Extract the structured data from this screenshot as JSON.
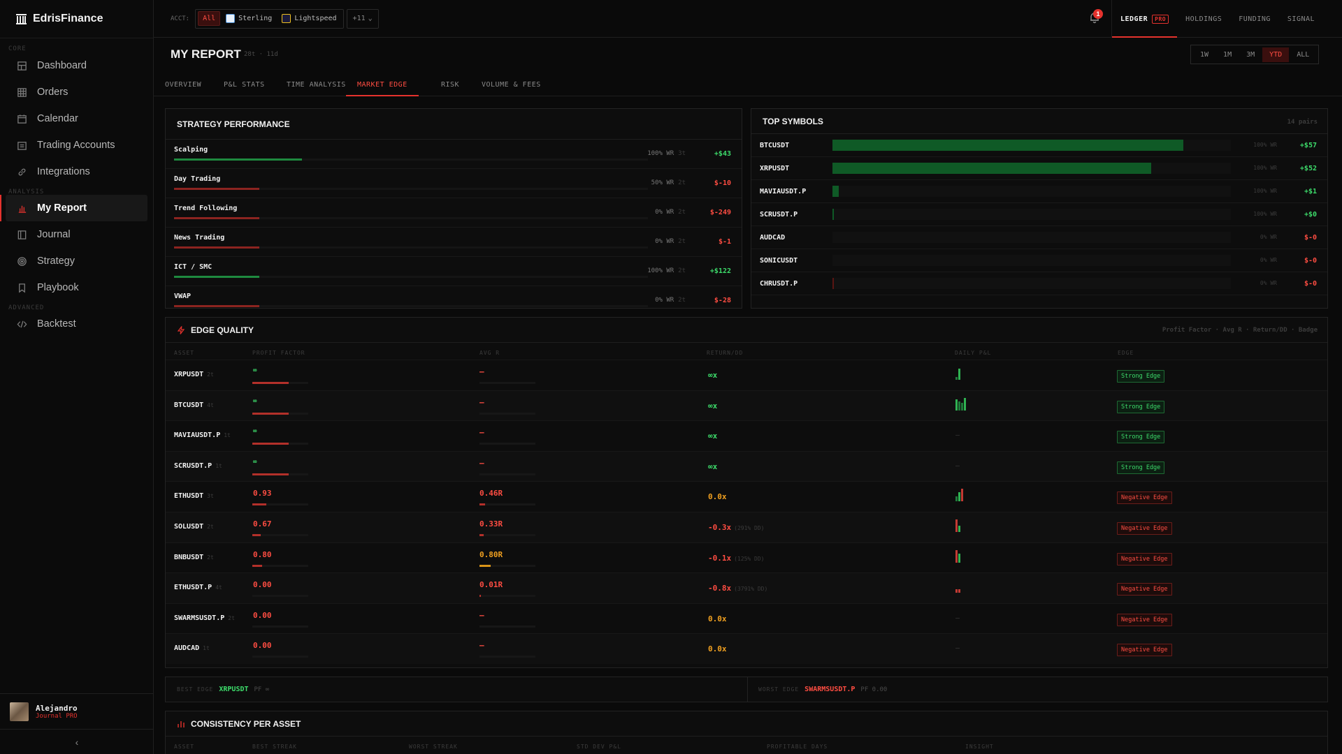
{
  "brand": {
    "name": "EdrisFinance"
  },
  "sidebar": {
    "sections": {
      "core": "CORE",
      "analysis": "ANALYSIS",
      "advanced": "ADVANCED"
    },
    "items": [
      {
        "label": "Dashboard",
        "icon": "dashboard-icon"
      },
      {
        "label": "Orders",
        "icon": "grid-icon"
      },
      {
        "label": "Calendar",
        "icon": "calendar-icon"
      },
      {
        "label": "Trading Accounts",
        "icon": "wallet-icon"
      },
      {
        "label": "Integrations",
        "icon": "link-icon"
      },
      {
        "label": "My Report",
        "icon": "bar-chart-icon",
        "active": true
      },
      {
        "label": "Journal",
        "icon": "book-icon"
      },
      {
        "label": "Strategy",
        "icon": "target-icon"
      },
      {
        "label": "Playbook",
        "icon": "bookmark-icon"
      },
      {
        "label": "Backtest",
        "icon": "code-icon"
      }
    ],
    "user": {
      "name": "Alejandro",
      "plan": "Journal PRO"
    },
    "collapse": "‹"
  },
  "topbar": {
    "acct_label": "ACCT:",
    "accounts": [
      "All",
      "Sterling",
      "Lightspeed"
    ],
    "more": "+11",
    "notification_count": "1",
    "nav": [
      {
        "label": "LEDGER",
        "tag": "PRO",
        "active": true
      },
      {
        "label": "HOLDINGS"
      },
      {
        "label": "FUNDING"
      },
      {
        "label": "SIGNAL"
      }
    ]
  },
  "page": {
    "title": "MY REPORT",
    "subtitle": "28t · 11d",
    "ranges": [
      "1W",
      "1M",
      "3M",
      "YTD",
      "ALL"
    ],
    "active_range": "YTD",
    "tabs": [
      "OVERVIEW",
      "P&L STATS",
      "TIME ANALYSIS",
      "MARKET EDGE",
      "RISK",
      "VOLUME & FEES"
    ],
    "active_tab": "MARKET EDGE"
  },
  "strategy_performance": {
    "title": "STRATEGY PERFORMANCE",
    "rows": [
      {
        "name": "Scalping",
        "wr": "100% WR",
        "trades": "3t",
        "pnl": "+$43",
        "positive": true,
        "bar_fraction": 0.27
      },
      {
        "name": "Day Trading",
        "wr": "50% WR",
        "trades": "2t",
        "pnl": "$-10",
        "positive": false,
        "bar_fraction": 0.18
      },
      {
        "name": "Trend Following",
        "wr": "0% WR",
        "trades": "2t",
        "pnl": "$-249",
        "positive": false,
        "bar_fraction": 0.18
      },
      {
        "name": "News Trading",
        "wr": "0% WR",
        "trades": "2t",
        "pnl": "$-1",
        "positive": false,
        "bar_fraction": 0.18
      },
      {
        "name": "ICT / SMC",
        "wr": "100% WR",
        "trades": "2t",
        "pnl": "+$122",
        "positive": true,
        "bar_fraction": 0.18
      },
      {
        "name": "VWAP",
        "wr": "0% WR",
        "trades": "2t",
        "pnl": "$-28",
        "positive": false,
        "bar_fraction": 0.18
      }
    ]
  },
  "top_symbols": {
    "title": "TOP SYMBOLS",
    "count": "14 pairs",
    "rows": [
      {
        "name": "BTCUSDT",
        "wr": "100% WR",
        "pnl": "+$57",
        "positive": true,
        "bar_fraction": 0.88
      },
      {
        "name": "XRPUSDT",
        "wr": "100% WR",
        "pnl": "+$52",
        "positive": true,
        "bar_fraction": 0.8
      },
      {
        "name": "MAVIAUSDT.P",
        "wr": "100% WR",
        "pnl": "+$1",
        "positive": true,
        "bar_fraction": 0.015
      },
      {
        "name": "SCRUSDT.P",
        "wr": "100% WR",
        "pnl": "+$0",
        "positive": true,
        "bar_fraction": 0.002
      },
      {
        "name": "AUDCAD",
        "wr": "0% WR",
        "pnl": "$-0",
        "positive": false,
        "bar_fraction": 0
      },
      {
        "name": "SONICUSDT",
        "wr": "0% WR",
        "pnl": "$-0",
        "positive": false,
        "bar_fraction": 0
      },
      {
        "name": "CHRUSDT.P",
        "wr": "0% WR",
        "pnl": "$-0",
        "positive": false,
        "bar_fraction": 0.002
      }
    ]
  },
  "edge_quality": {
    "title": "EDGE QUALITY",
    "legend": "Profit Factor · Avg R · Return/DD · Badge",
    "columns": [
      "ASSET",
      "PROFIT FACTOR",
      "AVG R",
      "RETURN/DD",
      "DAILY P&L",
      "EDGE"
    ],
    "rows": [
      {
        "asset": "XRPUSDT",
        "trades": "2t",
        "pf": "∞",
        "pf_color": "green",
        "pf_fill": 0.65,
        "avgr": "—",
        "avgr_color": "red",
        "avgr_fill": 0,
        "ret": "∞x",
        "ret_color": "green",
        "ret_dd": "",
        "daily": [
          0.2,
          0.9
        ],
        "daily_colors": [
          "#1f7a3a",
          "#2fb352"
        ],
        "edge": "Strong Edge",
        "strong": true
      },
      {
        "asset": "BTCUSDT",
        "trades": "4t",
        "pf": "∞",
        "pf_color": "green",
        "pf_fill": 0.65,
        "avgr": "—",
        "avgr_color": "red",
        "avgr_fill": 0,
        "ret": "∞x",
        "ret_color": "green",
        "ret_dd": "",
        "daily": [
          0.9,
          0.7,
          0.6,
          1.0
        ],
        "daily_colors": [
          "#2fb352",
          "#1f7a3a",
          "#1f7a3a",
          "#2fb352"
        ],
        "edge": "Strong Edge",
        "strong": true
      },
      {
        "asset": "MAVIAUSDT.P",
        "trades": "1t",
        "pf": "∞",
        "pf_color": "green",
        "pf_fill": 0.65,
        "avgr": "—",
        "avgr_color": "red",
        "avgr_fill": 0,
        "ret": "∞x",
        "ret_color": "green",
        "ret_dd": "",
        "daily": [],
        "daily_colors": [],
        "edge": "Strong Edge",
        "strong": true
      },
      {
        "asset": "SCRUSDT.P",
        "trades": "1t",
        "pf": "∞",
        "pf_color": "green",
        "pf_fill": 0.65,
        "avgr": "—",
        "avgr_color": "red",
        "avgr_fill": 0,
        "ret": "∞x",
        "ret_color": "green",
        "ret_dd": "",
        "daily": [],
        "daily_colors": [],
        "edge": "Strong Edge",
        "strong": true
      },
      {
        "asset": "ETHUSDT",
        "trades": "3t",
        "pf": "0.93",
        "pf_color": "red",
        "pf_fill": 0.25,
        "avgr": "0.46R",
        "avgr_color": "red",
        "avgr_fill": 0.1,
        "ret": "0.0x",
        "ret_color": "amber",
        "ret_dd": "",
        "daily": [
          0.4,
          0.7,
          1.0
        ],
        "daily_colors": [
          "#1f7a3a",
          "#2fb352",
          "#c23a33"
        ],
        "edge": "Negative Edge",
        "strong": false
      },
      {
        "asset": "SOLUSDT",
        "trades": "2t",
        "pf": "0.67",
        "pf_color": "red",
        "pf_fill": 0.15,
        "avgr": "0.33R",
        "avgr_color": "red",
        "avgr_fill": 0.08,
        "ret": "-0.3x",
        "ret_color": "red",
        "ret_dd": "(291% DD)",
        "daily": [
          1.0,
          0.5
        ],
        "daily_colors": [
          "#c23a33",
          "#2fb352"
        ],
        "edge": "Negative Edge",
        "strong": false
      },
      {
        "asset": "BNBUSDT",
        "trades": "2t",
        "pf": "0.80",
        "pf_color": "red",
        "pf_fill": 0.18,
        "avgr": "0.80R",
        "avgr_color": "amber",
        "avgr_fill": 0.2,
        "ret": "-0.1x",
        "ret_color": "red",
        "ret_dd": "(125% DD)",
        "daily": [
          1.0,
          0.7
        ],
        "daily_colors": [
          "#c23a33",
          "#2fb352"
        ],
        "edge": "Negative Edge",
        "strong": false
      },
      {
        "asset": "ETHUSDT.P",
        "trades": "4t",
        "pf": "0.00",
        "pf_color": "red",
        "pf_fill": 0,
        "avgr": "0.01R",
        "avgr_color": "red",
        "avgr_fill": 0.01,
        "ret": "-0.8x",
        "ret_color": "red",
        "ret_dd": "(3791% DD)",
        "daily": [
          0.25,
          0.3
        ],
        "daily_colors": [
          "#c23a33",
          "#c23a33"
        ],
        "edge": "Negative Edge",
        "strong": false
      },
      {
        "asset": "SWARMSUSDT.P",
        "trades": "2t",
        "pf": "0.00",
        "pf_color": "red",
        "pf_fill": 0,
        "avgr": "—",
        "avgr_color": "red",
        "avgr_fill": 0,
        "ret": "0.0x",
        "ret_color": "amber",
        "ret_dd": "",
        "daily": [],
        "daily_colors": [],
        "edge": "Negative Edge",
        "strong": false
      },
      {
        "asset": "AUDCAD",
        "trades": "1t",
        "pf": "0.00",
        "pf_color": "red",
        "pf_fill": 0,
        "avgr": "—",
        "avgr_color": "red",
        "avgr_fill": 0,
        "ret": "0.0x",
        "ret_color": "amber",
        "ret_dd": "",
        "daily": [],
        "daily_colors": [],
        "edge": "Negative Edge",
        "strong": false
      }
    ]
  },
  "best_worst": {
    "best_label": "BEST EDGE",
    "best_asset": "XRPUSDT",
    "best_pf": "PF ∞",
    "worst_label": "WORST EDGE",
    "worst_asset": "SWARMSUSDT.P",
    "worst_pf": "PF 0.00"
  },
  "consistency": {
    "title": "CONSISTENCY PER ASSET",
    "columns": [
      "ASSET",
      "BEST STREAK",
      "WORST STREAK",
      "STD DEV P&L",
      "PROFITABLE DAYS",
      "INSIGHT"
    ]
  },
  "colors": {
    "accent": "#e5322d",
    "positive": "#3ddc6b",
    "negative": "#ff4d42",
    "warning": "#f0a020"
  }
}
